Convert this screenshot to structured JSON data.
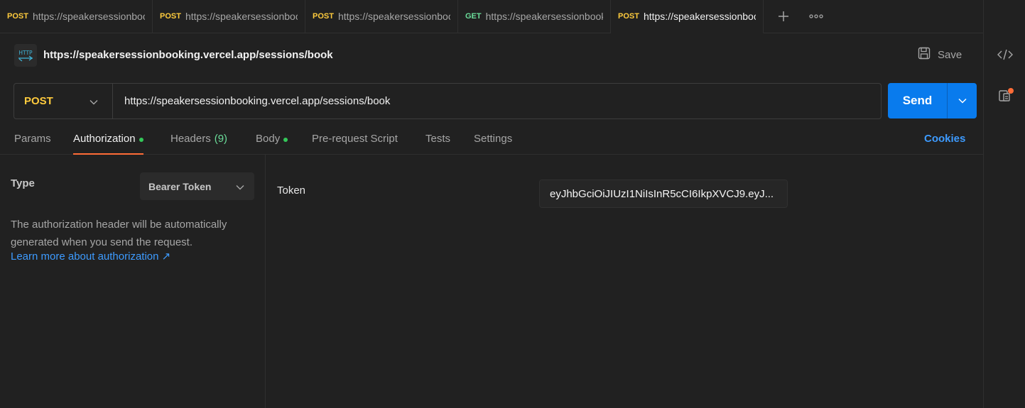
{
  "tabs": [
    {
      "method": "POST",
      "url": "https://speakersessionbooking.vercel.app/sessions/book"
    },
    {
      "method": "POST",
      "url": "https://speakersessionbooking.vercel.app/sessions/book"
    },
    {
      "method": "POST",
      "url": "https://speakersessionbooking.vercel.app/sessions/book"
    },
    {
      "method": "GET",
      "url": "https://speakersessionbooking.vercel.app/sessions"
    },
    {
      "method": "POST",
      "url": "https://speakersessionbooking.vercel.app/sessions/book"
    }
  ],
  "active_tab_index": 4,
  "request": {
    "title": "https://speakersessionbooking.vercel.app/sessions/book",
    "method": "POST",
    "url": "https://speakersessionbooking.vercel.app/sessions/book",
    "save_label": "Save",
    "send_label": "Send",
    "http_badge": "HTTP"
  },
  "request_tabs": {
    "params": "Params",
    "authorization": "Authorization",
    "headers": "Headers",
    "headers_count": "(9)",
    "body": "Body",
    "pre_request": "Pre-request Script",
    "tests": "Tests",
    "settings": "Settings",
    "cookies": "Cookies"
  },
  "auth": {
    "type_label": "Type",
    "type_value": "Bearer Token",
    "description": "The authorization header will be automatically generated when you send the request.",
    "learn_more": "Learn more about authorization ↗",
    "token_label": "Token",
    "token_value": "eyJhbGciOiJIUzI1NiIsInR5cCI6IkpXVCJ9.eyJ..."
  },
  "colors": {
    "accent": "#ff6c37",
    "post": "#ffcb3d",
    "get": "#6bdd9a",
    "send": "#097bed",
    "link": "#3d9bff"
  }
}
